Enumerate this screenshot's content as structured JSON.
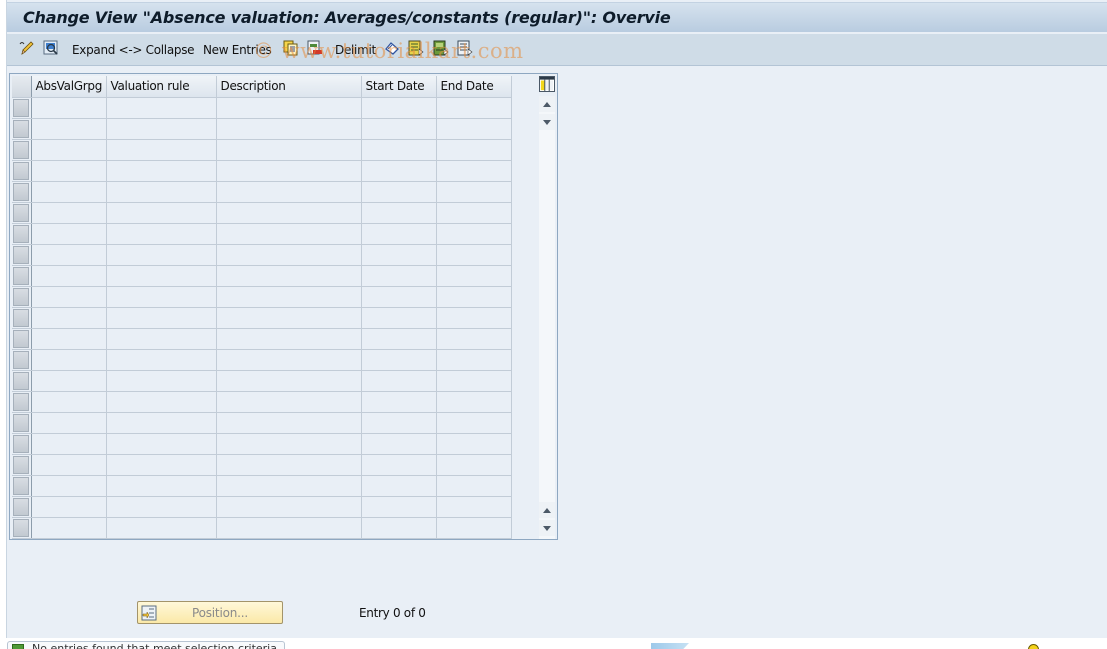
{
  "window": {
    "title": "Change View \"Absence valuation: Averages/constants (regular)\": Overvie"
  },
  "toolbar": {
    "items": [
      {
        "type": "icon",
        "name": "display-change-icon"
      },
      {
        "type": "icon",
        "name": "select-detail-icon"
      },
      {
        "type": "button",
        "label": "Expand <-> Collapse"
      },
      {
        "type": "button",
        "label": "New Entries"
      },
      {
        "type": "icon",
        "name": "copy-as-icon"
      },
      {
        "type": "icon",
        "name": "delete-icon"
      },
      {
        "type": "button",
        "label": "Delimit"
      },
      {
        "type": "icon",
        "name": "undo-change-icon"
      },
      {
        "type": "icon",
        "name": "select-all-icon"
      },
      {
        "type": "icon",
        "name": "select-block-icon"
      },
      {
        "type": "icon",
        "name": "deselect-all-icon"
      }
    ],
    "expand_collapse_label": "Expand <-> Collapse",
    "new_entries_label": "New Entries",
    "delimit_label": "Delimit"
  },
  "watermark": "© www.tutorialkart.com",
  "table": {
    "columns": [
      "AbsValGrpg",
      "Valuation rule",
      "Description",
      "Start Date",
      "End Date"
    ],
    "visible_row_count": 21,
    "rows": []
  },
  "footer": {
    "position_button_label": "Position...",
    "entry_count": "Entry 0 of 0"
  },
  "statusbar": {
    "message": "No entries found that meet selection criteria"
  }
}
